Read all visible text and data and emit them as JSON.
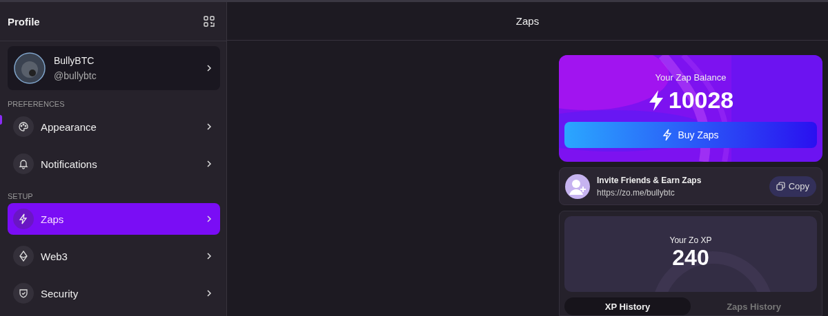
{
  "sidebar": {
    "title": "Profile",
    "profile": {
      "name": "BullyBTC",
      "handle": "@bullybtc"
    },
    "sections": [
      {
        "heading": "PREFERENCES",
        "items": [
          {
            "label": "Appearance",
            "selected": false
          },
          {
            "label": "Notifications",
            "selected": false
          }
        ]
      },
      {
        "heading": "SETUP",
        "items": [
          {
            "label": "Zaps",
            "selected": true
          },
          {
            "label": "Web3",
            "selected": false
          },
          {
            "label": "Security",
            "selected": false
          }
        ]
      }
    ]
  },
  "header": {
    "title": "Zaps"
  },
  "balance": {
    "label": "Your Zap Balance",
    "amount": "10028",
    "button": "Buy Zaps"
  },
  "invite": {
    "title": "Invite Friends & Earn Zaps",
    "link": "https://zo.me/bullybtc",
    "button": "Copy"
  },
  "xp": {
    "label": "Your Zo XP",
    "amount": "240",
    "tabs": [
      {
        "label": "XP History",
        "selected": true
      },
      {
        "label": "Zaps History",
        "selected": false
      }
    ]
  }
}
